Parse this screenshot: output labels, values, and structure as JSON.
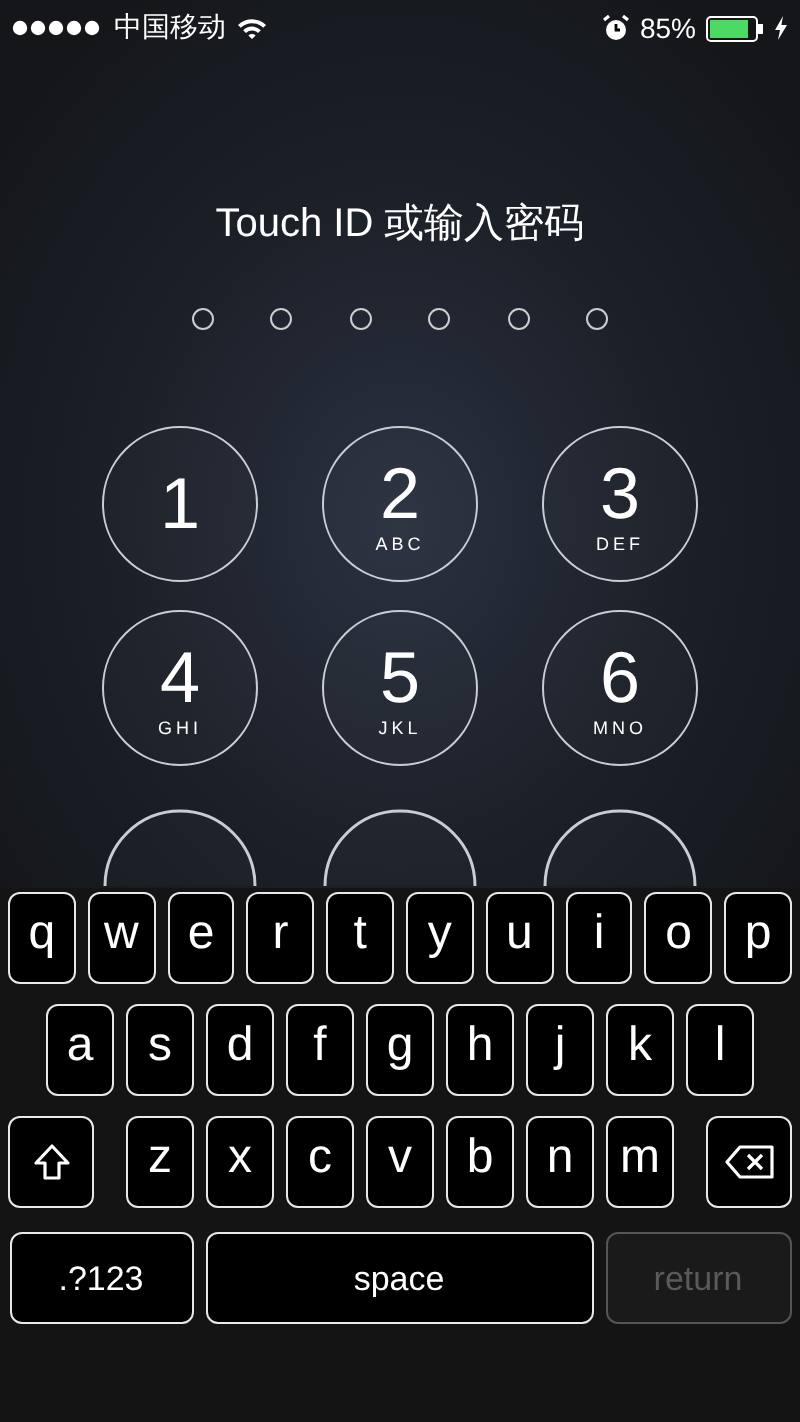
{
  "status_bar": {
    "carrier": "中国移动",
    "battery_percent": "85%"
  },
  "prompt": "Touch ID 或输入密码",
  "passcode_dots": [
    {
      "filled": false
    },
    {
      "filled": false
    },
    {
      "filled": false
    },
    {
      "filled": false
    },
    {
      "filled": false
    },
    {
      "filled": false
    }
  ],
  "keypad": [
    {
      "digit": "1"
    },
    {
      "digit": "2",
      "letters": "ABC"
    },
    {
      "digit": "3",
      "letters": "DEF"
    },
    {
      "digit": "4",
      "letters": "GHI"
    },
    {
      "digit": "5",
      "letters": "JKL"
    },
    {
      "digit": "6",
      "letters": "MNO"
    }
  ],
  "keyboard": {
    "rows": [
      {
        "keys": [
          {
            "kind": "letter",
            "label": "q"
          },
          {
            "kind": "letter",
            "label": "w"
          },
          {
            "kind": "letter",
            "label": "e"
          },
          {
            "kind": "letter",
            "label": "r"
          },
          {
            "kind": "letter",
            "label": "t"
          },
          {
            "kind": "letter",
            "label": "y"
          },
          {
            "kind": "letter",
            "label": "u"
          },
          {
            "kind": "letter",
            "label": "i"
          },
          {
            "kind": "letter",
            "label": "o"
          },
          {
            "kind": "letter",
            "label": "p"
          }
        ]
      },
      {
        "keys": [
          {
            "kind": "letter",
            "label": "a"
          },
          {
            "kind": "letter",
            "label": "s"
          },
          {
            "kind": "letter",
            "label": "d"
          },
          {
            "kind": "letter",
            "label": "f"
          },
          {
            "kind": "letter",
            "label": "g"
          },
          {
            "kind": "letter",
            "label": "h"
          },
          {
            "kind": "letter",
            "label": "j"
          },
          {
            "kind": "letter",
            "label": "k"
          },
          {
            "kind": "letter",
            "label": "l"
          }
        ]
      },
      {
        "keys": [
          {
            "kind": "shift"
          },
          {
            "kind": "letter",
            "label": "z"
          },
          {
            "kind": "letter",
            "label": "x"
          },
          {
            "kind": "letter",
            "label": "c"
          },
          {
            "kind": "letter",
            "label": "v"
          },
          {
            "kind": "letter",
            "label": "b"
          },
          {
            "kind": "letter",
            "label": "n"
          },
          {
            "kind": "letter",
            "label": "m"
          },
          {
            "kind": "delete"
          }
        ]
      },
      {
        "keys": [
          {
            "kind": "mode",
            "label": ".?123"
          },
          {
            "kind": "space",
            "label": "space"
          },
          {
            "kind": "return",
            "label": "return",
            "disabled": true
          }
        ]
      }
    ]
  }
}
